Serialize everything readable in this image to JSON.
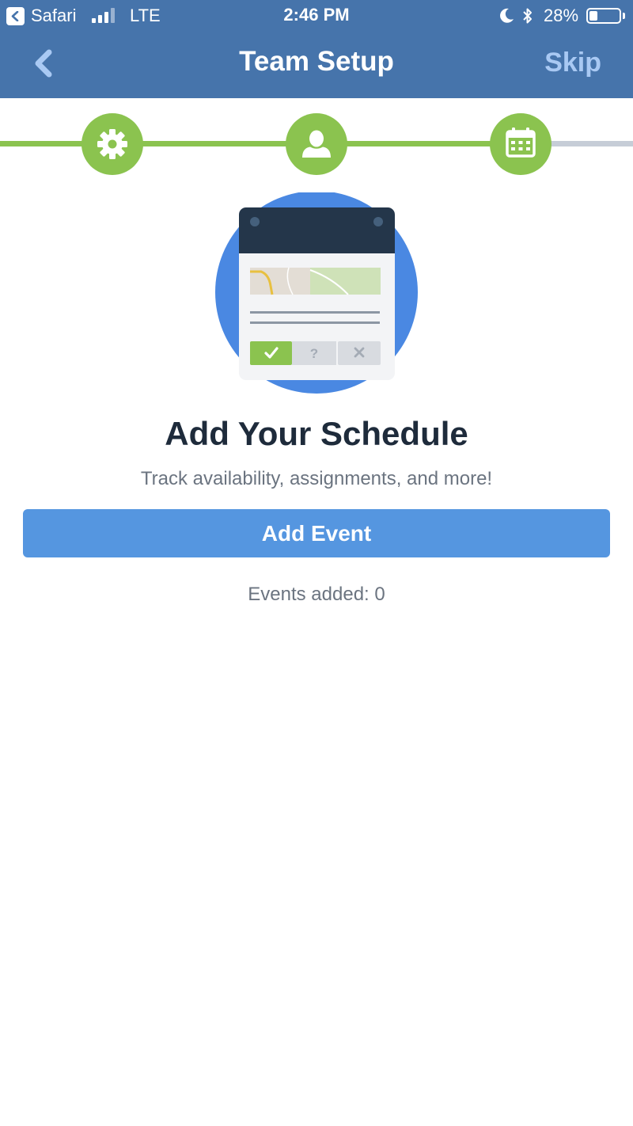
{
  "status_bar": {
    "back_app": "Safari",
    "network": "LTE",
    "time": "2:46 PM",
    "battery": "28%",
    "battery_level": 0.28,
    "signal_bars_filled": 3,
    "icons": [
      "back-arrow-icon",
      "signal-icon",
      "moon-icon",
      "bluetooth-icon",
      "battery-icon"
    ]
  },
  "nav": {
    "title": "Team Setup",
    "skip_label": "Skip",
    "back_icon": "chevron-left-icon"
  },
  "steps": [
    {
      "icon": "gear-icon",
      "done": true
    },
    {
      "icon": "person-icon",
      "done": true
    },
    {
      "icon": "calendar-icon",
      "done": true
    }
  ],
  "colors": {
    "header": "#4674ab",
    "step_active": "#8bc34f",
    "step_track_inactive": "#c6cdd7",
    "primary_button": "#5596e0",
    "heading": "#1e2b3b"
  },
  "content": {
    "heading": "Add Your Schedule",
    "subtext": "Track availability, assignments, and more!",
    "add_event_label": "Add Event",
    "events_count": "Events added: 0"
  }
}
